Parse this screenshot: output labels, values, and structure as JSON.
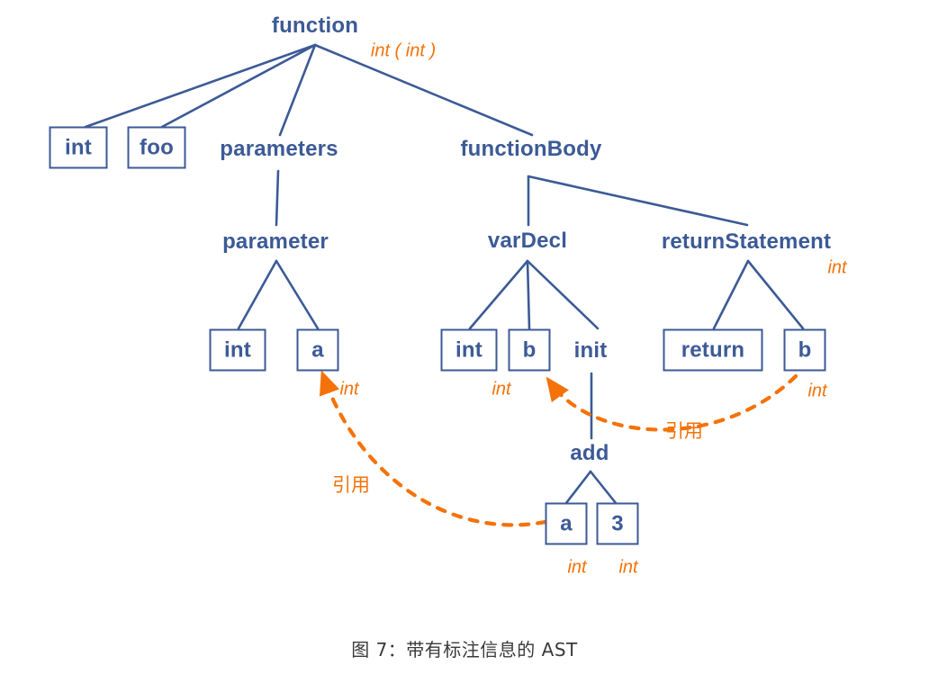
{
  "figure": {
    "caption": "图 7：带有标注信息的 AST",
    "colors": {
      "node": "#3C5A96",
      "annotation": "#F57209",
      "background": "#FFFFFF"
    }
  },
  "nodes": {
    "function": "function",
    "int_ret": "int",
    "foo": "foo",
    "parameters": "parameters",
    "function_body": "functionBody",
    "parameter": "parameter",
    "var_decl": "varDecl",
    "return_statement": "returnStatement",
    "param_int": "int",
    "param_a": "a",
    "vardecl_int": "int",
    "vardecl_b": "b",
    "init": "init",
    "return_kw": "return",
    "return_b": "b",
    "add": "add",
    "add_a": "a",
    "add_3": "3"
  },
  "annotations": {
    "function_type": "int ( int )",
    "return_statement_type": "int",
    "param_a_type": "int",
    "vardecl_b_type": "int",
    "return_b_type": "int",
    "add_a_type": "int",
    "add_3_type": "int",
    "ref_left": "引用",
    "ref_right": "引用"
  },
  "chart_data": {
    "type": "diagram",
    "title": "图 7：带有标注信息的 AST",
    "tree": {
      "label": "function",
      "annotation": "int ( int )",
      "children": [
        {
          "label": "int",
          "boxed": true
        },
        {
          "label": "foo",
          "boxed": true
        },
        {
          "label": "parameters",
          "children": [
            {
              "label": "parameter",
              "children": [
                {
                  "label": "int",
                  "boxed": true
                },
                {
                  "label": "a",
                  "boxed": true,
                  "annotation": "int"
                }
              ]
            }
          ]
        },
        {
          "label": "functionBody",
          "children": [
            {
              "label": "varDecl",
              "children": [
                {
                  "label": "int",
                  "boxed": true
                },
                {
                  "label": "b",
                  "boxed": true,
                  "annotation": "int"
                },
                {
                  "label": "init",
                  "children": [
                    {
                      "label": "add",
                      "children": [
                        {
                          "label": "a",
                          "boxed": true,
                          "annotation": "int"
                        },
                        {
                          "label": "3",
                          "boxed": true,
                          "annotation": "int"
                        }
                      ]
                    }
                  ]
                }
              ]
            },
            {
              "label": "returnStatement",
              "annotation": "int",
              "children": [
                {
                  "label": "return",
                  "boxed": true
                },
                {
                  "label": "b",
                  "boxed": true,
                  "annotation": "int"
                }
              ]
            }
          ]
        }
      ]
    },
    "reference_edges": [
      {
        "from": "add.a",
        "to": "parameter.a",
        "label": "引用",
        "style": "dashed-orange-arrow"
      },
      {
        "from": "returnStatement.b",
        "to": "varDecl.b",
        "label": "引用",
        "style": "dashed-orange-arrow"
      }
    ]
  }
}
